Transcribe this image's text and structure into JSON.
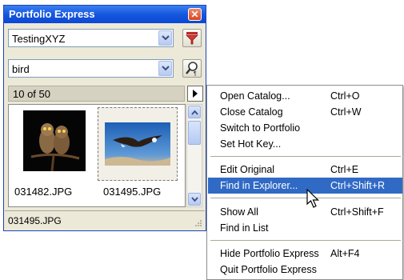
{
  "window": {
    "title": "Portfolio Express",
    "catalog_combo_value": "TestingXYZ",
    "search_combo_value": "bird",
    "count_text": "10 of 50",
    "status_text": "031495.JPG"
  },
  "thumbnails": [
    {
      "filename": "031482.JPG",
      "subject": "two owls on a branch",
      "selected": false
    },
    {
      "filename": "031495.JPG",
      "subject": "eagle in flight",
      "selected": true
    }
  ],
  "menu": {
    "groups": [
      [
        {
          "label": "Open Catalog...",
          "shortcut": "Ctrl+O"
        },
        {
          "label": "Close Catalog",
          "shortcut": "Ctrl+W"
        },
        {
          "label": "Switch to Portfolio",
          "shortcut": ""
        },
        {
          "label": "Set Hot Key...",
          "shortcut": ""
        }
      ],
      [
        {
          "label": "Edit Original",
          "shortcut": "Ctrl+E"
        },
        {
          "label": "Find in Explorer...",
          "shortcut": "Ctrl+Shift+R",
          "highlighted": true
        }
      ],
      [
        {
          "label": "Show All",
          "shortcut": "Ctrl+Shift+F"
        },
        {
          "label": "Find in List",
          "shortcut": ""
        }
      ],
      [
        {
          "label": "Hide Portfolio Express",
          "shortcut": "Alt+F4"
        },
        {
          "label": "Quit Portfolio Express",
          "shortcut": ""
        }
      ]
    ]
  },
  "icons": {
    "close": "close-icon",
    "filter": "filter-icon",
    "search": "magnifier-icon",
    "menu_arrow": "play-arrow-icon",
    "cursor": "mouse-pointer-icon"
  },
  "colors": {
    "title_bar": "#0b48d5",
    "menu_highlight": "#316ac5",
    "window_bg": "#ece9d8"
  }
}
